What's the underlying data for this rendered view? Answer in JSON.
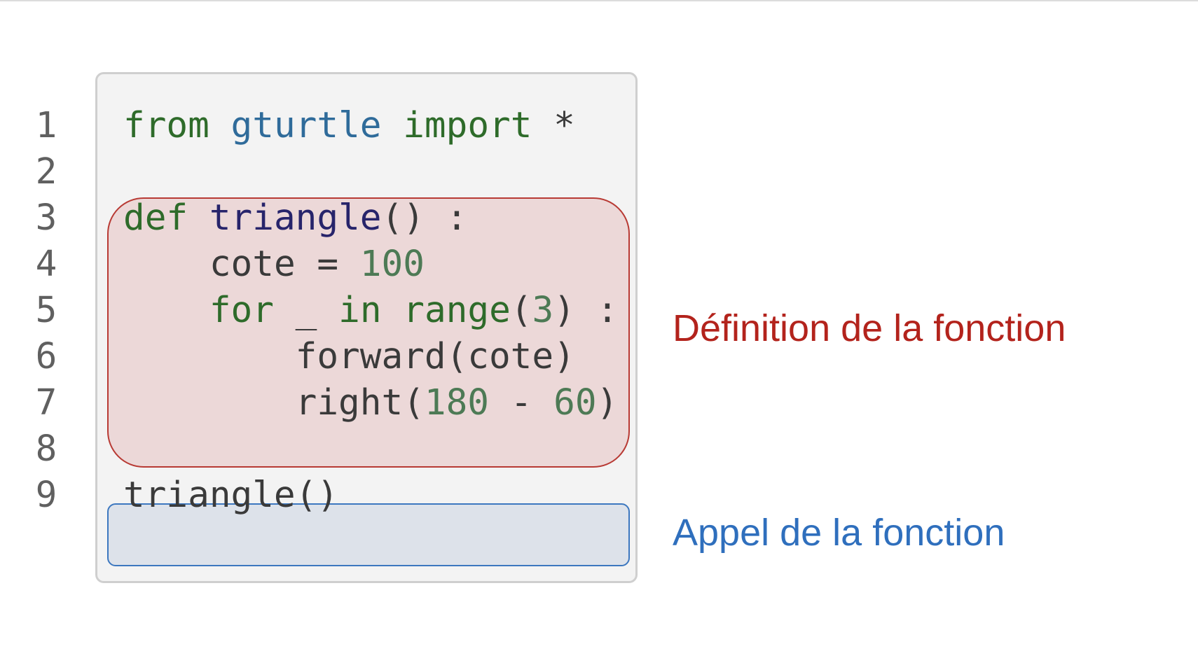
{
  "line_numbers": [
    "1",
    "2",
    "3",
    "4",
    "5",
    "6",
    "7",
    "8",
    "9"
  ],
  "code": {
    "line1": {
      "kw_from": "from",
      "module": "gturtle",
      "kw_import": "import",
      "star": "*"
    },
    "line3": {
      "kw_def": "def",
      "fn_name": "triangle",
      "rest": "() :"
    },
    "line4": {
      "var": "cote",
      "op": " = ",
      "num": "100"
    },
    "line5": {
      "kw_for": "for",
      "underscore": "_",
      "kw_in": "in",
      "builtin": "range",
      "open": "(",
      "num": "3",
      "close": ") :"
    },
    "line6": {
      "text": "forward(cote)"
    },
    "line7": {
      "fn": "right(",
      "num1": "180",
      "op": " - ",
      "num2": "60",
      "close": ")"
    },
    "line9": {
      "text": "triangle()"
    }
  },
  "annotations": {
    "definition": "Définition de la fonction",
    "call": "Appel de la fonction"
  },
  "colors": {
    "definition_accent": "#b3231c",
    "call_accent": "#2f6fbd",
    "keyword": "#2e6b2a",
    "module": "#2f6b9a",
    "number": "#4d7a55"
  }
}
